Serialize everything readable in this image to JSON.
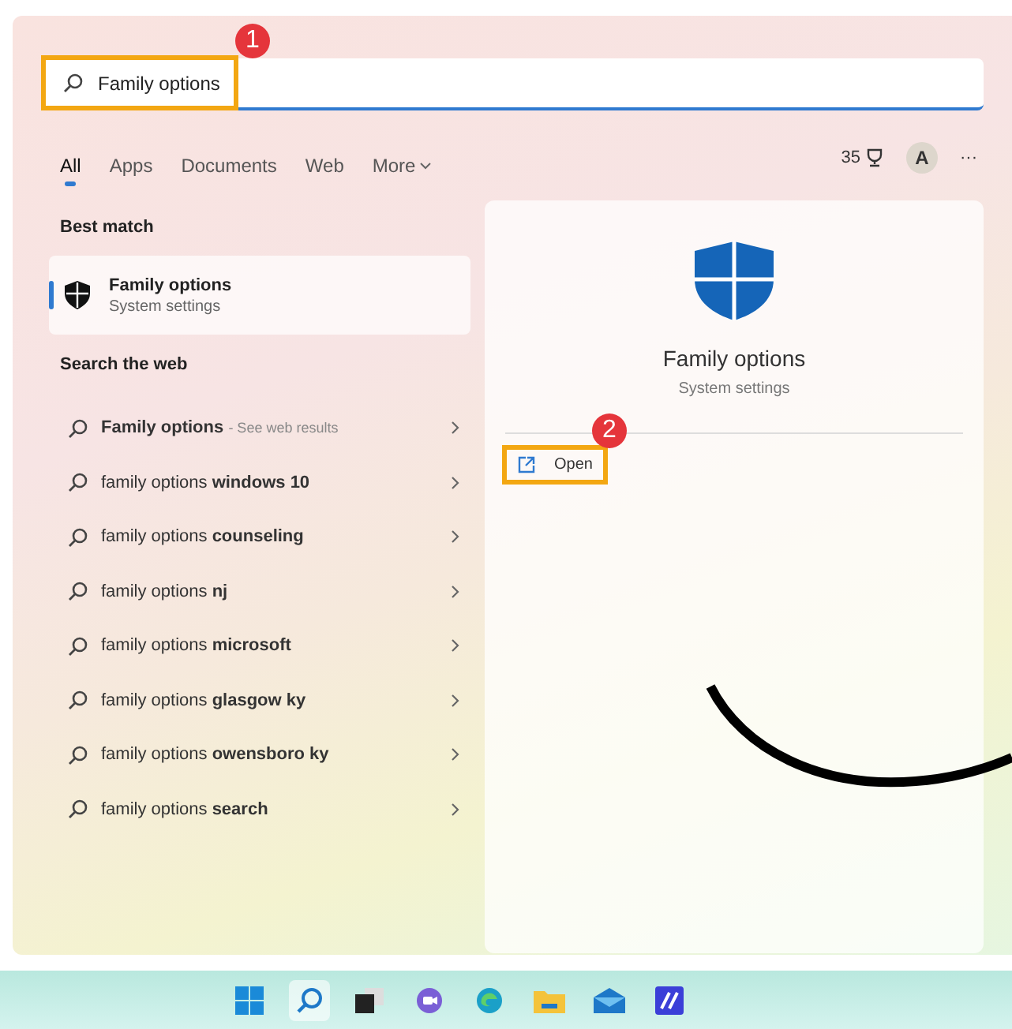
{
  "search": {
    "value": "Family options",
    "highlighted": true,
    "callout": "1"
  },
  "tabs": [
    {
      "label": "All",
      "selected": true
    },
    {
      "label": "Apps",
      "selected": false
    },
    {
      "label": "Documents",
      "selected": false
    },
    {
      "label": "Web",
      "selected": false
    },
    {
      "label": "More",
      "selected": false
    }
  ],
  "toolbar": {
    "points": "35",
    "avatar": "A",
    "more": "···"
  },
  "best_match": {
    "heading": "Best match",
    "title": "Family options",
    "subtitle": "System settings",
    "selected": true
  },
  "web": {
    "heading": "Search the web",
    "items": [
      {
        "query": "**Family options**",
        "hint": "- See web results"
      },
      {
        "query": "family options **windows 10**"
      },
      {
        "query": "family options **counseling**"
      },
      {
        "query": "family options **nj**"
      },
      {
        "query": "family options **microsoft**"
      },
      {
        "query": "family options **glasgow ky**"
      },
      {
        "query": "family options **owensboro ky**"
      },
      {
        "query": "family options **search**"
      }
    ]
  },
  "preview": {
    "title": "Family options",
    "subtitle": "System settings",
    "action": "Open",
    "action_highlighted": true,
    "callout": "2"
  },
  "taskbar": [
    {
      "kind": "start",
      "selected": false
    },
    {
      "kind": "search",
      "selected": true
    },
    {
      "kind": "taskview",
      "selected": false
    },
    {
      "kind": "chat",
      "selected": false
    },
    {
      "kind": "edge",
      "selected": false
    },
    {
      "kind": "folder",
      "selected": false
    },
    {
      "kind": "mail",
      "selected": false
    },
    {
      "kind": "app",
      "selected": false
    }
  ]
}
